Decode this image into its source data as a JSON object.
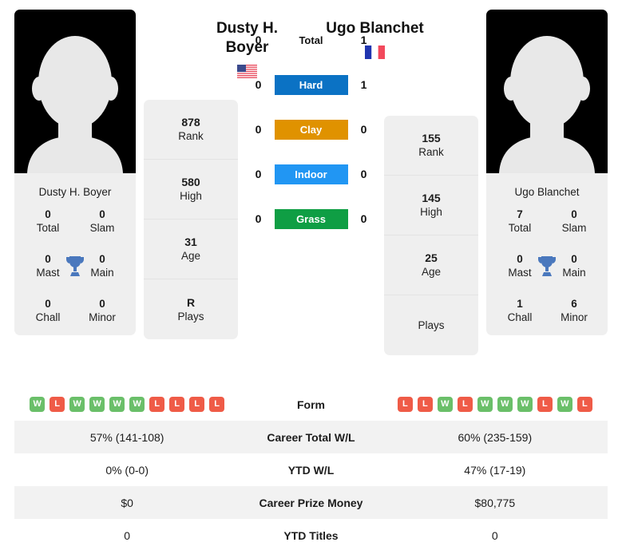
{
  "players": {
    "left": {
      "display_name_line1": "Dusty H.",
      "display_name_line2": "Boyer",
      "card_name": "Dusty H. Boyer",
      "country_flag": "us-flag-icon",
      "avatar": "player-silhouette-placeholder",
      "titles": [
        {
          "value": "0",
          "label": "Total"
        },
        {
          "value": "0",
          "label": "Slam"
        },
        {
          "value": "0",
          "label": "Mast"
        },
        {
          "value": "0",
          "label": "Main"
        },
        {
          "value": "0",
          "label": "Chall"
        },
        {
          "value": "0",
          "label": "Minor"
        }
      ],
      "rank_cells": [
        {
          "value": "878",
          "label": "Rank"
        },
        {
          "value": "580",
          "label": "High"
        },
        {
          "value": "31",
          "label": "Age"
        },
        {
          "value": "R",
          "label": "Plays"
        }
      ],
      "form": [
        "W",
        "L",
        "W",
        "W",
        "W",
        "W",
        "L",
        "L",
        "L",
        "L"
      ]
    },
    "right": {
      "display_name_line1": "Ugo Blanchet",
      "display_name_line2": "",
      "card_name": "Ugo Blanchet",
      "country_flag": "fr-flag-icon",
      "avatar": "player-silhouette-placeholder",
      "titles": [
        {
          "value": "7",
          "label": "Total"
        },
        {
          "value": "0",
          "label": "Slam"
        },
        {
          "value": "0",
          "label": "Mast"
        },
        {
          "value": "0",
          "label": "Main"
        },
        {
          "value": "1",
          "label": "Chall"
        },
        {
          "value": "6",
          "label": "Minor"
        }
      ],
      "rank_cells": [
        {
          "value": "155",
          "label": "Rank"
        },
        {
          "value": "145",
          "label": "High"
        },
        {
          "value": "25",
          "label": "Age"
        },
        {
          "value": "",
          "label": "Plays"
        }
      ],
      "form": [
        "L",
        "L",
        "W",
        "L",
        "W",
        "W",
        "W",
        "L",
        "W",
        "L"
      ]
    }
  },
  "surfaces": [
    {
      "label": "Total",
      "left": "0",
      "right": "1",
      "color": "transparent"
    },
    {
      "label": "Hard",
      "left": "0",
      "right": "1",
      "color": "#0b72c4"
    },
    {
      "label": "Clay",
      "left": "0",
      "right": "0",
      "color": "#e09200"
    },
    {
      "label": "Indoor",
      "left": "0",
      "right": "0",
      "color": "#2196f3"
    },
    {
      "label": "Grass",
      "left": "0",
      "right": "0",
      "color": "#0f9e44"
    }
  ],
  "table": {
    "form_label": "Form",
    "rows": [
      {
        "label": "Career Total W/L",
        "left": "57% (141-108)",
        "right": "60% (235-159)"
      },
      {
        "label": "YTD W/L",
        "left": "0% (0-0)",
        "right": "47% (17-19)"
      },
      {
        "label": "Career Prize Money",
        "left": "$0",
        "right": "$80,775"
      },
      {
        "label": "YTD Titles",
        "left": "0",
        "right": "0"
      }
    ]
  },
  "colors": {
    "win_badge": "#6abf69",
    "loss_badge": "#ef5b47",
    "card_bg": "#efefef",
    "trophy": "#4a78bd"
  }
}
